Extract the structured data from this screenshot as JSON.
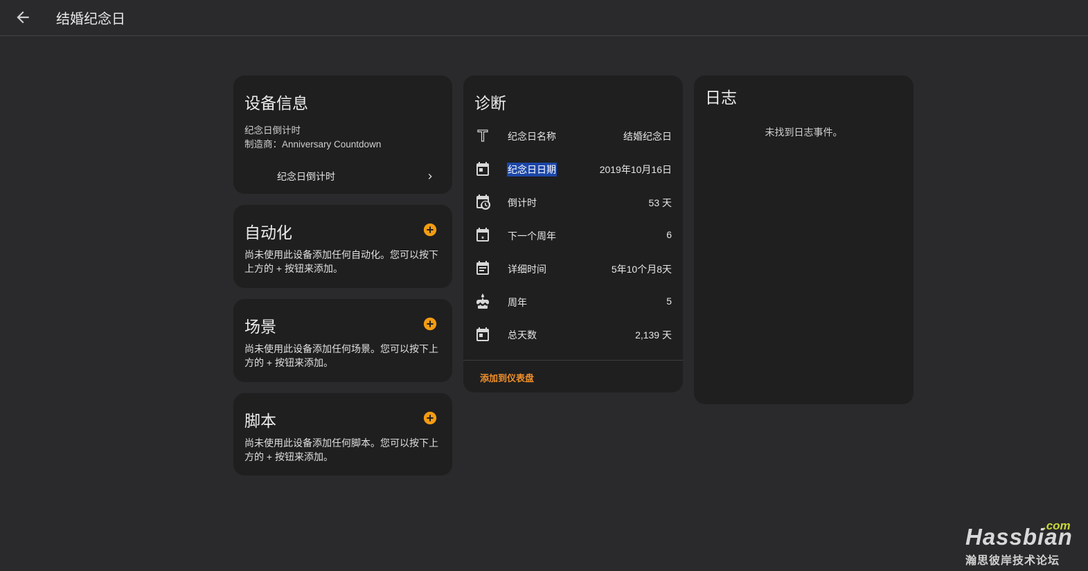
{
  "header": {
    "title": "结婚纪念日",
    "back_icon": "arrow-left-icon"
  },
  "device_info": {
    "title": "设备信息",
    "model": "纪念日倒计时",
    "manufacturer_label": "制造商：",
    "manufacturer": "Anniversary Countdown",
    "link_label": "纪念日倒计时"
  },
  "automation": {
    "title": "自动化",
    "description": "尚未使用此设备添加任何自动化。您可以按下上方的 + 按钮来添加。"
  },
  "scene": {
    "title": "场景",
    "description": "尚未使用此设备添加任何场景。您可以按下上方的 + 按钮来添加。"
  },
  "script": {
    "title": "脚本",
    "description": "尚未使用此设备添加任何脚本。您可以按下上方的 + 按钮来添加。"
  },
  "diagnostics": {
    "title": "诊断",
    "rows": [
      {
        "icon": "format-text-icon",
        "label": "纪念日名称",
        "value": "结婚纪念日"
      },
      {
        "icon": "calendar-today-icon",
        "label": "纪念日日期",
        "value": "2019年10月16日",
        "selected": true
      },
      {
        "icon": "calendar-clock-icon",
        "label": "倒计时",
        "value": "53 天"
      },
      {
        "icon": "calendar-star-icon",
        "label": "下一个周年",
        "value": "6"
      },
      {
        "icon": "calendar-text-icon",
        "label": "详细时间",
        "value": "5年10个月8天"
      },
      {
        "icon": "cake-icon",
        "label": "周年",
        "value": "5"
      },
      {
        "icon": "calendar-icon",
        "label": "总天数",
        "value": "2,139 天"
      }
    ],
    "action": "添加到仪表盘"
  },
  "logbook": {
    "title": "日志",
    "empty": "未找到日志事件。"
  },
  "watermark": {
    "com": ".com",
    "main": "Hassbian",
    "sub": "瀚思彼岸技术论坛"
  },
  "colors": {
    "background": "#2a2a2c",
    "card": "#1f1f20",
    "accent": "#f0902a",
    "plus_button": "#f39c12",
    "selection": "#1c47a8"
  }
}
